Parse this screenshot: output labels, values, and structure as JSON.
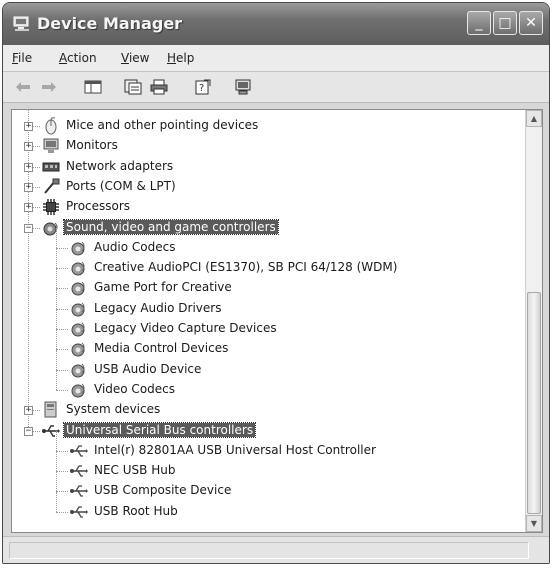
{
  "window": {
    "title": "Device Manager",
    "controls": {
      "minimize": "_",
      "maximize": "□",
      "close": "✕"
    }
  },
  "menu": [
    {
      "label_rest": "ile",
      "underline": "F"
    },
    {
      "label_rest": "ction",
      "underline": "A"
    },
    {
      "label_rest": "iew",
      "underline": "V"
    },
    {
      "label_rest": "elp",
      "underline": "H"
    }
  ],
  "toolbar": {
    "icons": [
      "back-arrow-icon",
      "forward-arrow-icon",
      "show-hide-console-tree-icon",
      "properties-icon",
      "print-icon",
      "help-icon",
      "scan-hardware-icon"
    ]
  },
  "tree": {
    "categories": [
      {
        "label": "Mice and other pointing devices",
        "expander": "+",
        "icon": "mouse-icon"
      },
      {
        "label": "Monitors",
        "expander": "+",
        "icon": "monitor-icon"
      },
      {
        "label": "Network adapters",
        "expander": "+",
        "icon": "network-adapter-icon"
      },
      {
        "label": "Ports (COM & LPT)",
        "expander": "+",
        "icon": "port-icon"
      },
      {
        "label": "Processors",
        "expander": "+",
        "icon": "processor-icon"
      },
      {
        "label": "Sound, video and game controllers",
        "expander": "−",
        "icon": "sound-icon",
        "selected": true
      },
      {
        "label": "Audio Codecs",
        "child": true,
        "icon": "sound-device-icon"
      },
      {
        "label": "Creative AudioPCI (ES1370), SB PCI 64/128 (WDM)",
        "child": true,
        "icon": "sound-device-icon"
      },
      {
        "label": "Game Port for Creative",
        "child": true,
        "icon": "sound-device-icon"
      },
      {
        "label": "Legacy Audio Drivers",
        "child": true,
        "icon": "sound-device-icon"
      },
      {
        "label": "Legacy Video Capture Devices",
        "child": true,
        "icon": "sound-device-icon"
      },
      {
        "label": "Media Control Devices",
        "child": true,
        "icon": "sound-device-icon"
      },
      {
        "label": "USB Audio Device",
        "child": true,
        "icon": "sound-device-icon"
      },
      {
        "label": "Video Codecs",
        "child": true,
        "icon": "sound-device-icon"
      },
      {
        "label": "System devices",
        "expander": "+",
        "icon": "system-devices-icon"
      },
      {
        "label": "Universal Serial Bus controllers",
        "expander": "−",
        "icon": "usb-icon",
        "selected": true
      },
      {
        "label": "Intel(r) 82801AA USB Universal Host Controller",
        "child": true,
        "icon": "usb-device-icon"
      },
      {
        "label": "NEC USB Hub",
        "child": true,
        "icon": "usb-device-icon"
      },
      {
        "label": "USB Composite Device",
        "child": true,
        "icon": "usb-device-icon"
      },
      {
        "label": "USB Root Hub",
        "child": true,
        "icon": "usb-device-icon"
      }
    ]
  },
  "scrollbar": {
    "up": "▲",
    "down": "▼"
  },
  "status": {
    "text": ""
  }
}
